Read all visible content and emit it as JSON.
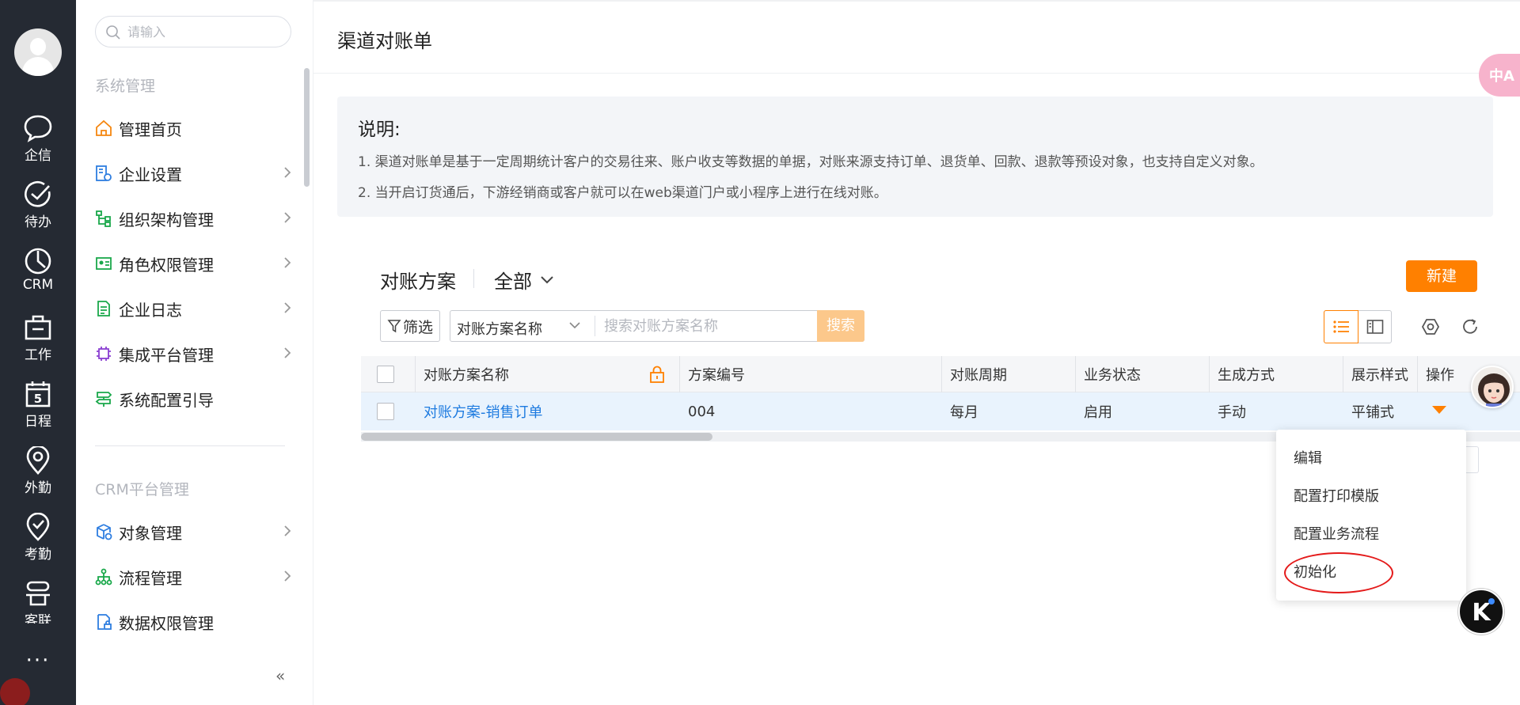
{
  "rail": {
    "items": [
      {
        "label": "企信",
        "icon": "chat-icon"
      },
      {
        "label": "待办",
        "icon": "check-circle-icon"
      },
      {
        "label": "CRM",
        "icon": "pie-chart-icon"
      },
      {
        "label": "工作",
        "icon": "briefcase-icon"
      },
      {
        "label": "日程",
        "icon": "calendar-icon"
      },
      {
        "label": "外勤",
        "icon": "location-pin-icon"
      },
      {
        "label": "考勤",
        "icon": "shield-check-icon"
      },
      {
        "label": "客联",
        "icon": "contacts-icon"
      }
    ],
    "calendar_day": "5",
    "more": "···"
  },
  "menu": {
    "search_placeholder": "请输入",
    "group1_title": "系统管理",
    "group1_items": [
      {
        "label": "管理首页",
        "has_chevron": false
      },
      {
        "label": "企业设置",
        "has_chevron": true
      },
      {
        "label": "组织架构管理",
        "has_chevron": true
      },
      {
        "label": "角色权限管理",
        "has_chevron": true
      },
      {
        "label": "企业日志",
        "has_chevron": true
      },
      {
        "label": "集成平台管理",
        "has_chevron": true
      },
      {
        "label": "系统配置引导",
        "has_chevron": false
      }
    ],
    "group2_title": "CRM平台管理",
    "group2_items": [
      {
        "label": "对象管理",
        "has_chevron": true
      },
      {
        "label": "流程管理",
        "has_chevron": true
      },
      {
        "label": "数据权限管理",
        "has_chevron": false
      }
    ],
    "collapse": "«"
  },
  "page": {
    "title": "渠道对账单",
    "notice": {
      "title": "说明:",
      "line1": "1. 渠道对账单是基于一定周期统计客户的交易往来、账户收支等数据的单据，对账来源支持订单、退货单、回款、退款等预设对象，也支持自定义对象。",
      "line2": "2. 当开启订货通后，下游经销商或客户就可以在web渠道门户或小程序上进行在线对账。"
    },
    "scheme_title": "对账方案",
    "scheme_filter": "全部",
    "new_button": "新建",
    "filter_button": "筛选",
    "search_field": "对账方案名称",
    "search_placeholder": "搜索对账方案名称",
    "search_button": "搜索"
  },
  "table": {
    "columns": [
      "对账方案名称",
      "方案编号",
      "对账周期",
      "业务状态",
      "生成方式",
      "展示样式",
      "操作"
    ],
    "rows": [
      {
        "name": "对账方案-销售订单",
        "code": "004",
        "cycle": "每月",
        "status": "启用",
        "mode": "手动",
        "style": "平铺式"
      }
    ]
  },
  "dropdown": {
    "items": [
      "编辑",
      "配置打印模版",
      "配置业务流程",
      "初始化"
    ]
  },
  "floating": {
    "translate_label": "中A",
    "k_label": "K"
  },
  "colors": {
    "accent": "#ff8000",
    "link": "#1e7be0",
    "rail_bg": "#252a33",
    "annotation": "#e41a1a"
  }
}
